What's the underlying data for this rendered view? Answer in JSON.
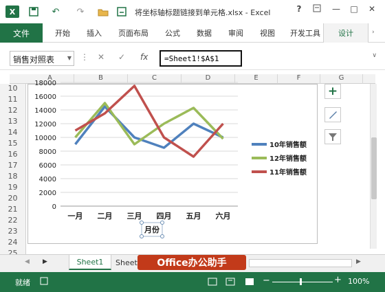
{
  "window": {
    "title": "将坐标轴标题链接到单元格.xlsx - Excel",
    "app_icon": "X",
    "help": "?",
    "minimize": "—",
    "restore": "□",
    "close": "✕"
  },
  "ribbon": {
    "tabs": [
      "文件",
      "开始",
      "插入",
      "页面布局",
      "公式",
      "数据",
      "审阅",
      "视图",
      "开发工具",
      "设计"
    ],
    "active_contextual": "设计"
  },
  "formula_bar": {
    "name_box": "销售对照表",
    "fx": "fx",
    "formula": "=Sheet1!$A$1"
  },
  "columns": [
    "A",
    "B",
    "C",
    "D",
    "E",
    "F",
    "G"
  ],
  "rows": [
    "10",
    "11",
    "12",
    "13",
    "14",
    "15",
    "16",
    "17",
    "18",
    "19",
    "20",
    "21",
    "22",
    "23",
    "24",
    "25"
  ],
  "chart_data": {
    "type": "line",
    "categories": [
      "一月",
      "二月",
      "三月",
      "四月",
      "五月",
      "六月"
    ],
    "series": [
      {
        "name": "10年销售额",
        "color": "#4f81bd",
        "values": [
          9000,
          14500,
          10000,
          8500,
          12000,
          10000
        ]
      },
      {
        "name": "12年销售额",
        "color": "#9bbb59",
        "values": [
          10000,
          15000,
          9000,
          12000,
          14300,
          9800
        ]
      },
      {
        "name": "11年销售额",
        "color": "#c0504d",
        "values": [
          11000,
          13500,
          17500,
          10000,
          7200,
          12000
        ]
      }
    ],
    "yticks": [
      "18000",
      "16000",
      "14000",
      "12000",
      "10000",
      "8000",
      "6000",
      "4000",
      "2000",
      "0"
    ],
    "ylim": [
      0,
      18000
    ],
    "xlabel": "月份",
    "grid": true,
    "legend_position": "right"
  },
  "side_buttons": [
    "plus-icon",
    "brush-icon",
    "filter-icon"
  ],
  "sheets": {
    "active": "Sheet1",
    "second": "Sheet"
  },
  "watermark": "Office办公助手",
  "status": {
    "ready": "就绪",
    "zoom": "100%"
  }
}
